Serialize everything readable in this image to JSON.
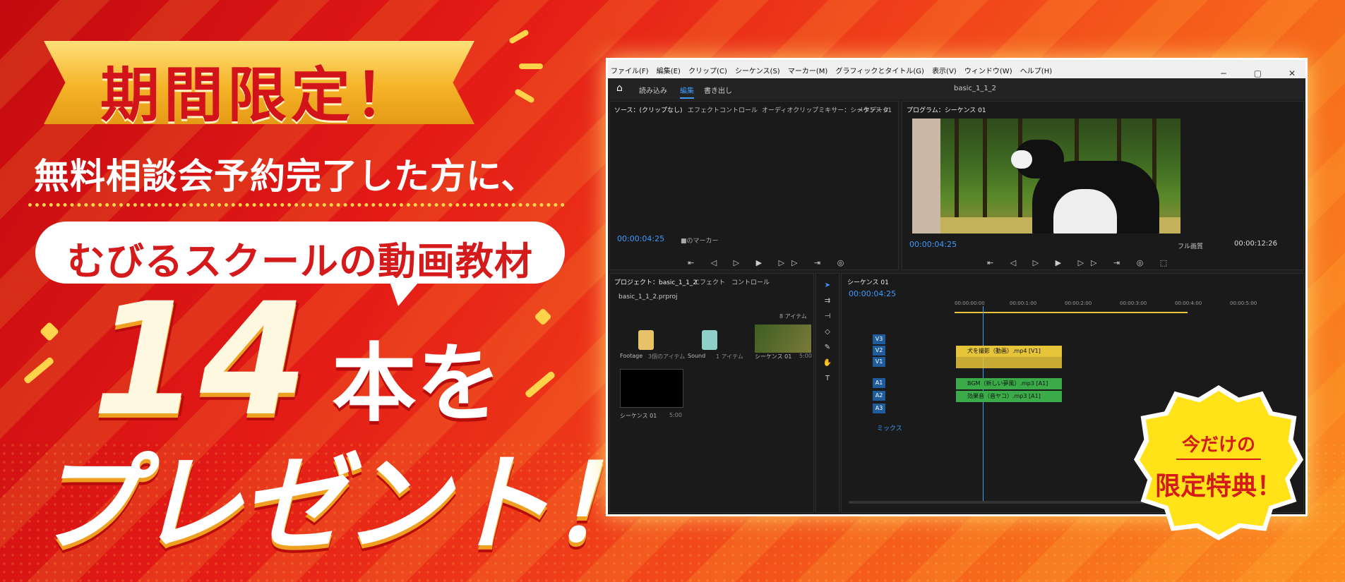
{
  "banner": {
    "ribbon_text": "期間限定！",
    "subtitle": "無料相談会予約完了した方に、",
    "bubble_text": "むびるスクールの動画教材",
    "count": "14",
    "count_suffix": "本を",
    "present": "プレゼント！"
  },
  "seal": {
    "line1": "今だけの",
    "line2": "限定特典！"
  },
  "app": {
    "menu": [
      "ファイル(F)",
      "編集(E)",
      "クリップ(C)",
      "シーケンス(S)",
      "マーカー(M)",
      "グラフィックとタイトル(G)",
      "表示(V)",
      "ウィンドウ(W)",
      "ヘルプ(H)"
    ],
    "window_controls": [
      "−",
      "▢",
      "✕"
    ],
    "header_tabs": [
      "読み込み",
      "編集",
      "書き出し"
    ],
    "project_name": "basic_1_1_2",
    "source_tabs": [
      "ソース：(クリップなし)",
      "エフェクトコントロール",
      "オーディオクリップミキサー：シーケンス 01",
      "メタデータ"
    ],
    "source_timecode": "00:00:04:25",
    "source_marker": "■のマーカー",
    "program_tab": "プログラム：シーケンス 01",
    "program_timecode": "00:00:04:25",
    "program_duration": "00:00:12:26",
    "program_quality": "フル画質",
    "project_tabs": [
      "プロジェクト：basic_1_1_2",
      "エフェクト",
      "コントロール"
    ],
    "project_file": "basic_1_1_2.prproj",
    "bin_count": "8 アイテム",
    "bins": [
      {
        "name": "Footage",
        "count": "3個のアイテム",
        "color": "#e8c268"
      },
      {
        "name": "Sound",
        "count": "1 アイテム",
        "color": "#8ed0c8"
      },
      {
        "name": "シーケンス 01",
        "count": "5:00",
        "color": "#445533"
      }
    ],
    "sequence_item": {
      "name": "シーケンス 01",
      "duration": "5:00"
    },
    "timeline_tab": "シーケンス 01",
    "timeline_timecode": "00:00:04:25",
    "ruler_ticks": [
      "00:00:00:00",
      "00:00:1:00",
      "00:00:2:00",
      "00:00:3:00",
      "00:00:4:00",
      "00:00:5:00"
    ],
    "video_tracks": [
      "V3",
      "V2",
      "V1"
    ],
    "audio_tracks": [
      "A1",
      "A2",
      "A3"
    ],
    "mix_label": "ミックス",
    "clips": [
      {
        "label": "犬を撮影（動画）.mp4 [V1]",
        "color": "#e6c53a"
      },
      {
        "label": "BGM（新しい夢風）.mp3 [A1]",
        "color": "#3bab4a"
      },
      {
        "label": "効果音（音ヤコ）.mp3 [A1]",
        "color": "#3bab4a"
      }
    ]
  }
}
